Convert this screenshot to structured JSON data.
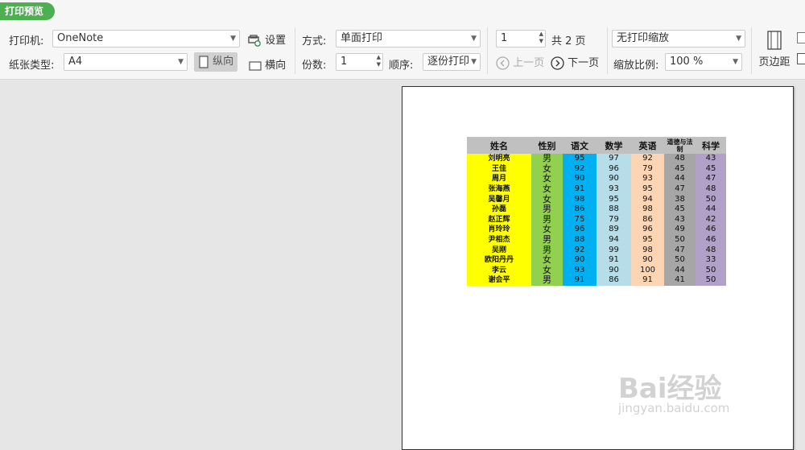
{
  "tab": "打印预览",
  "printer": {
    "label": "打印机:",
    "value": "OneNote",
    "settings": "设置"
  },
  "paper": {
    "label": "纸张类型:",
    "value": "A4",
    "portrait": "纵向",
    "landscape": "横向"
  },
  "mode": {
    "label": "方式:",
    "value": "单面打印"
  },
  "copies": {
    "label": "份数:",
    "value": "1",
    "order_label": "顺序:",
    "order_value": "逐份打印"
  },
  "pager": {
    "current": "1",
    "total": "共 2 页",
    "prev": "上一页",
    "next": "下一页"
  },
  "scale": {
    "mode": "无打印缩放",
    "label": "缩放比例:",
    "value": "100 %"
  },
  "margins": "页边距",
  "table": {
    "headers": [
      "姓名",
      "性别",
      "语文",
      "数学",
      "英语",
      "道德与法制",
      "科学"
    ],
    "rows": [
      [
        "刘明亮",
        "男",
        "95",
        "97",
        "92",
        "48",
        "43"
      ],
      [
        "王佳",
        "女",
        "92",
        "96",
        "79",
        "45",
        "45"
      ],
      [
        "周月",
        "女",
        "90",
        "90",
        "93",
        "44",
        "47"
      ],
      [
        "张海燕",
        "女",
        "91",
        "93",
        "95",
        "47",
        "48"
      ],
      [
        "吴馨月",
        "女",
        "98",
        "95",
        "94",
        "38",
        "50"
      ],
      [
        "孙磊",
        "男",
        "86",
        "88",
        "98",
        "45",
        "44"
      ],
      [
        "赵正辉",
        "男",
        "75",
        "79",
        "86",
        "43",
        "42"
      ],
      [
        "肖玲玲",
        "女",
        "96",
        "89",
        "96",
        "49",
        "46"
      ],
      [
        "尹相杰",
        "男",
        "88",
        "94",
        "95",
        "50",
        "46"
      ],
      [
        "吴刚",
        "男",
        "92",
        "99",
        "98",
        "47",
        "48"
      ],
      [
        "欧阳丹丹",
        "女",
        "90",
        "91",
        "90",
        "50",
        "33"
      ],
      [
        "李云",
        "女",
        "93",
        "90",
        "100",
        "44",
        "50"
      ],
      [
        "谢会平",
        "男",
        "91",
        "86",
        "91",
        "41",
        "50"
      ]
    ]
  },
  "watermark": {
    "main": "Bai经验",
    "url": "jingyan.baidu.com"
  }
}
